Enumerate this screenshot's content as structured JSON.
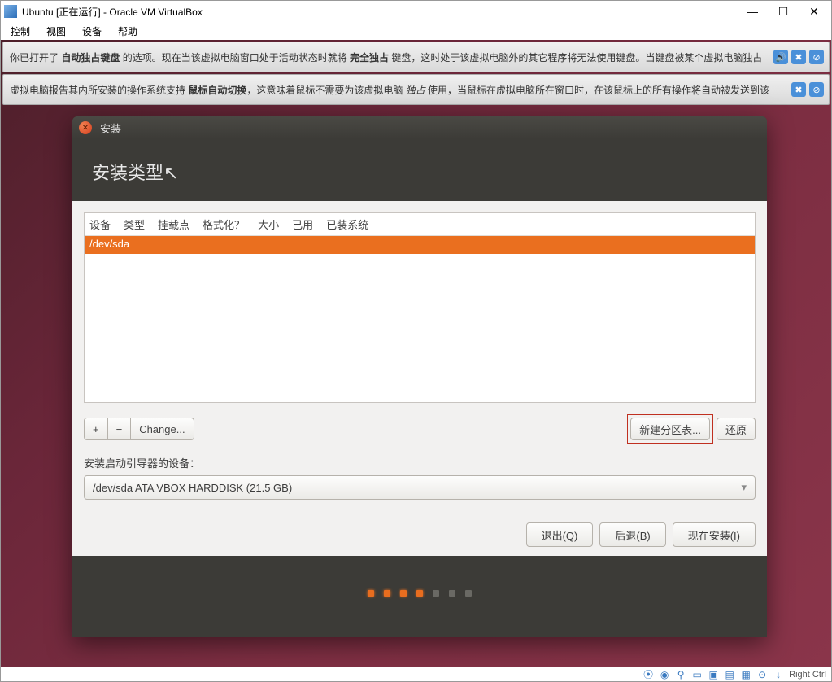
{
  "window": {
    "title": "Ubuntu [正在运行] - Oracle VM VirtualBox"
  },
  "menubar": {
    "control": "控制",
    "view": "视图",
    "devices": "设备",
    "help": "帮助"
  },
  "notifications": {
    "line1_pre": "你已打开了 ",
    "line1_b1": "自动独占键盘",
    "line1_mid": " 的选项。现在当该虚拟电脑窗口处于活动状态时就将 ",
    "line1_b2": "完全独占",
    "line1_post": " 键盘，这时处于该虚拟电脑外的其它程序将无法使用键盘。当键盘被某个虚拟电脑独占",
    "line2_pre": "虚拟电脑报告其内所安装的操作系统支持 ",
    "line2_b1": "鼠标自动切换",
    "line2_mid": "，这意味着鼠标不需要为该虚拟电脑 ",
    "line2_i": "独占",
    "line2_post": " 使用，当鼠标在虚拟电脑所在窗口时，在该鼠标上的所有操作将自动被发送到该"
  },
  "installer": {
    "titlebar": "安装",
    "heading": "安装类型",
    "columns": {
      "device": "设备",
      "type": "类型",
      "mount": "挂载点",
      "format": "格式化？",
      "size": "大小",
      "used": "已用",
      "system": "已装系统"
    },
    "row_device": "/dev/sda",
    "buttons": {
      "plus": "+",
      "minus": "−",
      "change": "Change...",
      "new_table": "新建分区表...",
      "restore": "还原"
    },
    "boot_label": "安装启动引导器的设备：",
    "boot_value": "/dev/sda  ATA VBOX HARDDISK (21.5 GB)",
    "nav": {
      "quit": "退出(Q)",
      "back": "后退(B)",
      "install": "现在安装(I)"
    }
  },
  "statusbar": {
    "hostkey": "Right Ctrl"
  }
}
